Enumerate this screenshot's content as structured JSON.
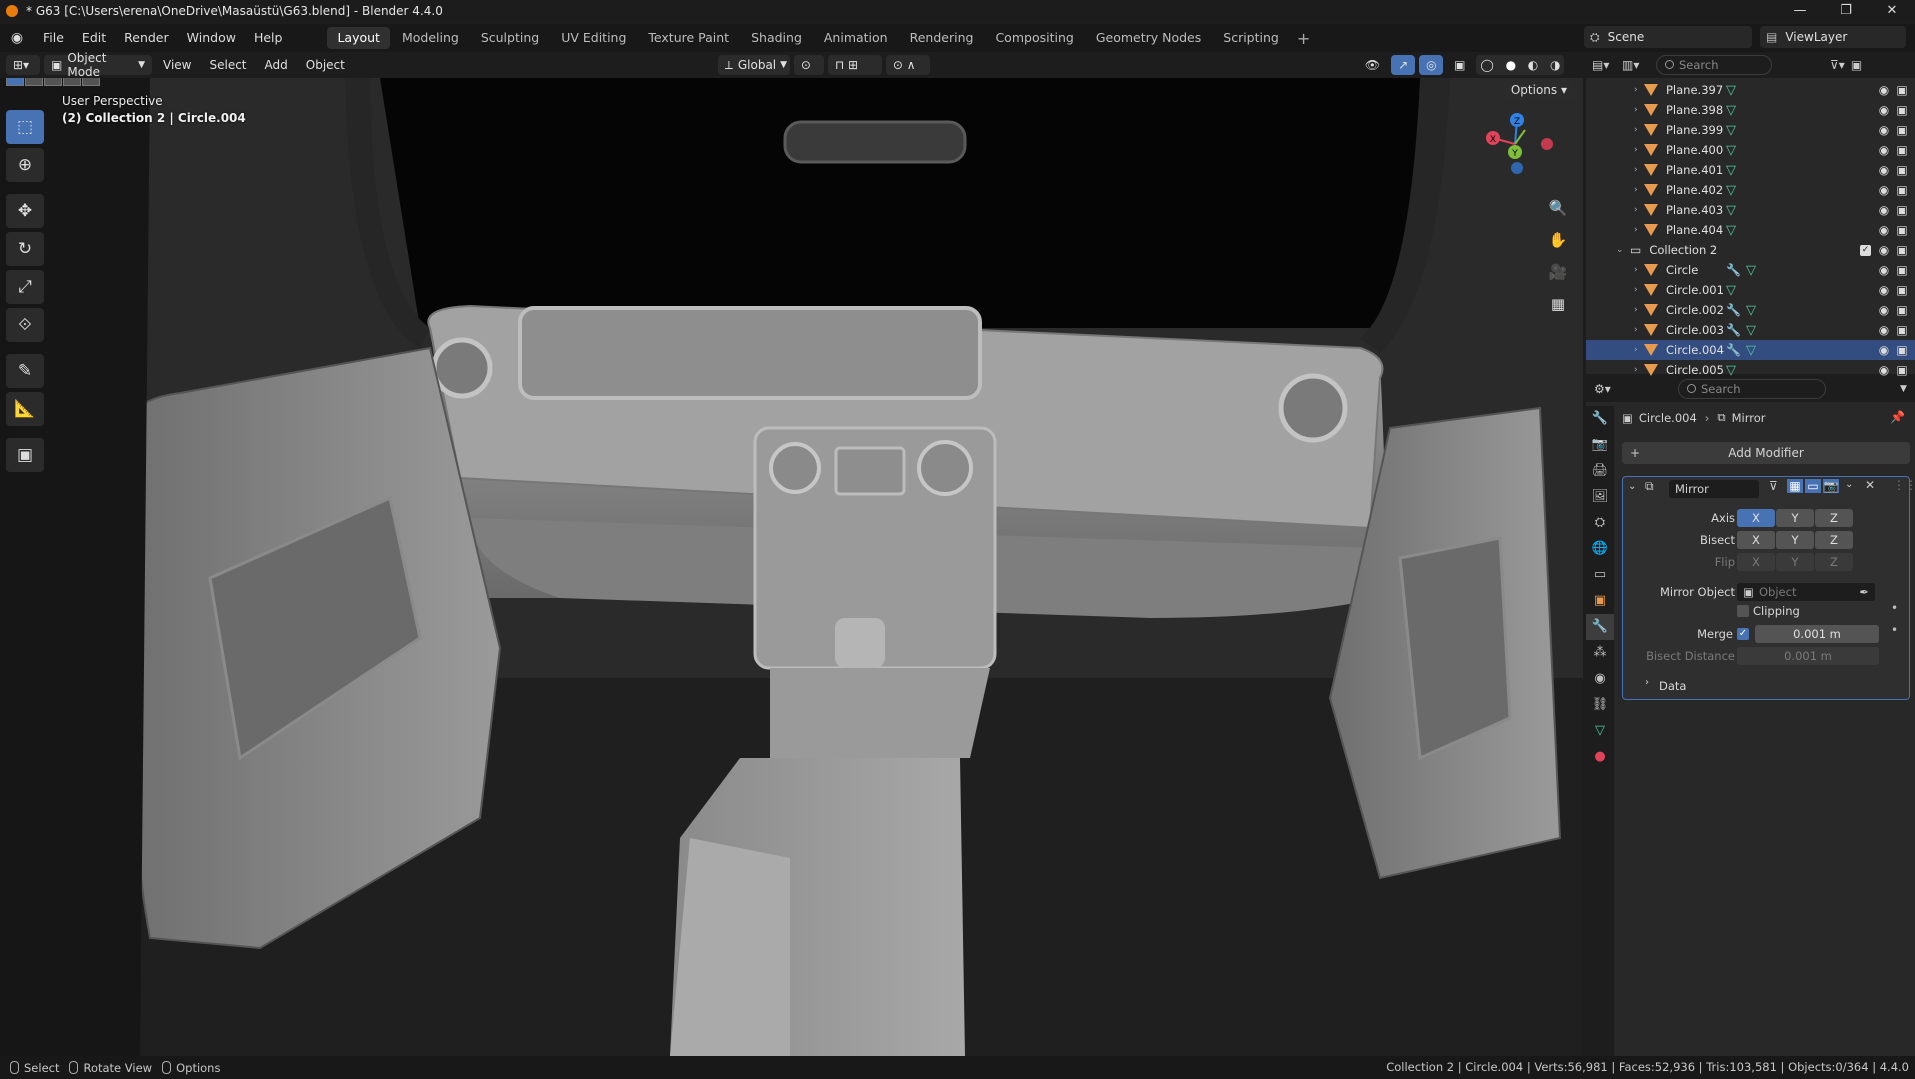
{
  "window": {
    "title": "* G63 [C:\\Users\\erena\\OneDrive\\Masaüstü\\G63.blend] - Blender 4.4.0",
    "controls": [
      "—",
      "❐",
      "✕"
    ]
  },
  "menubar": {
    "items": [
      "File",
      "Edit",
      "Render",
      "Window",
      "Help"
    ],
    "workspaces": [
      "Layout",
      "Modeling",
      "Sculpting",
      "UV Editing",
      "Texture Paint",
      "Shading",
      "Animation",
      "Rendering",
      "Compositing",
      "Geometry Nodes",
      "Scripting"
    ],
    "active_workspace": "Layout",
    "add_tab": "+",
    "scene": "Scene",
    "view_layer": "ViewLayer"
  },
  "viewport_header": {
    "mode": "Object Mode",
    "menus": [
      "View",
      "Select",
      "Add",
      "Object"
    ],
    "orientation": "Global",
    "options_label": "Options"
  },
  "viewport": {
    "perspective": "User Perspective",
    "context": "(2) Collection 2 | Circle.004",
    "gizmo": {
      "x": "X",
      "y": "Y",
      "z": "Z"
    }
  },
  "outliner": {
    "search_placeholder": "Search",
    "rows": [
      {
        "name": "Plane.397",
        "type": "mesh"
      },
      {
        "name": "Plane.398",
        "type": "mesh"
      },
      {
        "name": "Plane.399",
        "type": "mesh"
      },
      {
        "name": "Plane.400",
        "type": "mesh"
      },
      {
        "name": "Plane.401",
        "type": "mesh"
      },
      {
        "name": "Plane.402",
        "type": "mesh"
      },
      {
        "name": "Plane.403",
        "type": "mesh"
      },
      {
        "name": "Plane.404",
        "type": "mesh"
      },
      {
        "name": "Collection 2",
        "type": "collection"
      },
      {
        "name": "Circle",
        "type": "mesh",
        "modifier": true
      },
      {
        "name": "Circle.001",
        "type": "mesh"
      },
      {
        "name": "Circle.002",
        "type": "mesh",
        "modifier": true
      },
      {
        "name": "Circle.003",
        "type": "mesh",
        "modifier": true
      },
      {
        "name": "Circle.004",
        "type": "mesh",
        "modifier": true,
        "selected": true
      },
      {
        "name": "Circle.005",
        "type": "mesh"
      }
    ]
  },
  "properties": {
    "search_placeholder": "Search",
    "breadcrumb_object": "Circle.004",
    "breadcrumb_modifier": "Mirror",
    "add_modifier": "Add Modifier",
    "modifier": {
      "name": "Mirror",
      "axis_label": "Axis",
      "bisect_label": "Bisect",
      "flip_label": "Flip",
      "xyz": [
        "X",
        "Y",
        "Z"
      ],
      "mirror_object_label": "Mirror Object",
      "mirror_object_placeholder": "Object",
      "clipping_label": "Clipping",
      "merge_label": "Merge",
      "merge_value": "0.001 m",
      "bisect_distance_label": "Bisect Distance",
      "bisect_distance_value": "0.001 m",
      "data_label": "Data"
    }
  },
  "statusbar": {
    "select": "Select",
    "rotate": "Rotate View",
    "options": "Options",
    "stats": "Collection 2 | Circle.004 | Verts:56,981 | Faces:52,936 | Tris:103,581 | Objects:0/364 | 4.4.0"
  },
  "colors": {
    "accent": "#4772b3",
    "selected_row": "#334d80",
    "mesh_icon": "#4fc9a0",
    "object_icon": "#e89a4e"
  }
}
